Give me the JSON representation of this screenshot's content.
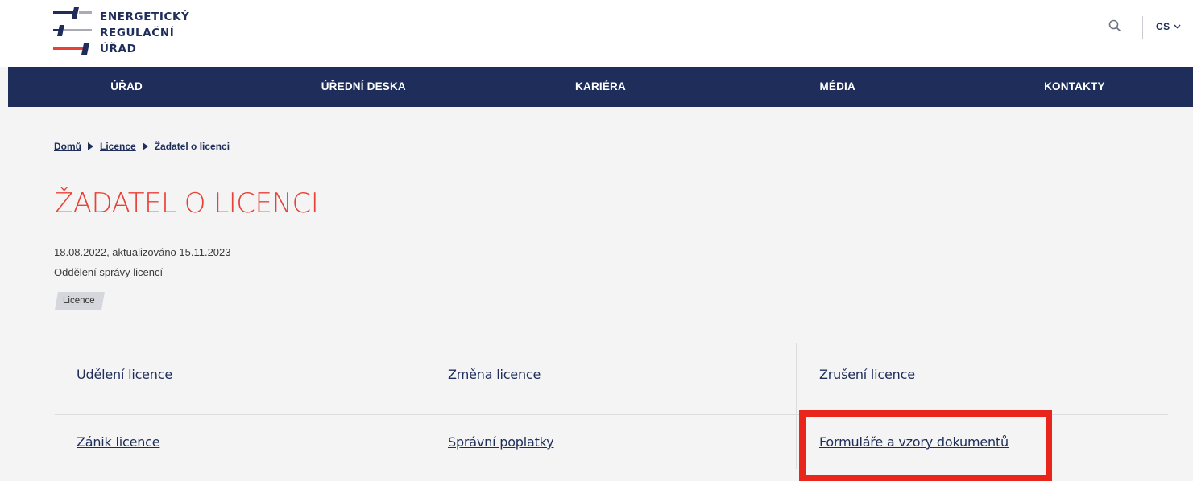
{
  "header": {
    "logo_lines": [
      "ENERGETICKÝ",
      "REGULAČNÍ",
      "ÚŘAD"
    ],
    "language": "CS",
    "colors": {
      "navy": "#1e2d5a",
      "red": "#e84136",
      "gray": "#a9acb2"
    }
  },
  "nav": {
    "items": [
      {
        "label": "ÚŘAD"
      },
      {
        "label": "ÚŘEDNÍ DESKA"
      },
      {
        "label": "KARIÉRA"
      },
      {
        "label": "MÉDIA"
      },
      {
        "label": "KONTAKTY"
      }
    ]
  },
  "breadcrumb": {
    "items": [
      {
        "label": "Domů"
      },
      {
        "label": "Licence"
      },
      {
        "label": "Žadatel o licenci"
      }
    ]
  },
  "page": {
    "title": "ŽADATEL O LICENCI",
    "date_line": "18.08.2022, aktualizováno 15.11.2023",
    "department": "Oddělení správy licencí",
    "tag": "Licence"
  },
  "links": [
    {
      "label": "Udělení licence"
    },
    {
      "label": "Změna licence"
    },
    {
      "label": "Zrušení licence"
    },
    {
      "label": "Zánik licence"
    },
    {
      "label": "Správní poplatky"
    },
    {
      "label": "Formuláře a vzory dokumentů"
    }
  ],
  "highlight_color": "#e8261c"
}
